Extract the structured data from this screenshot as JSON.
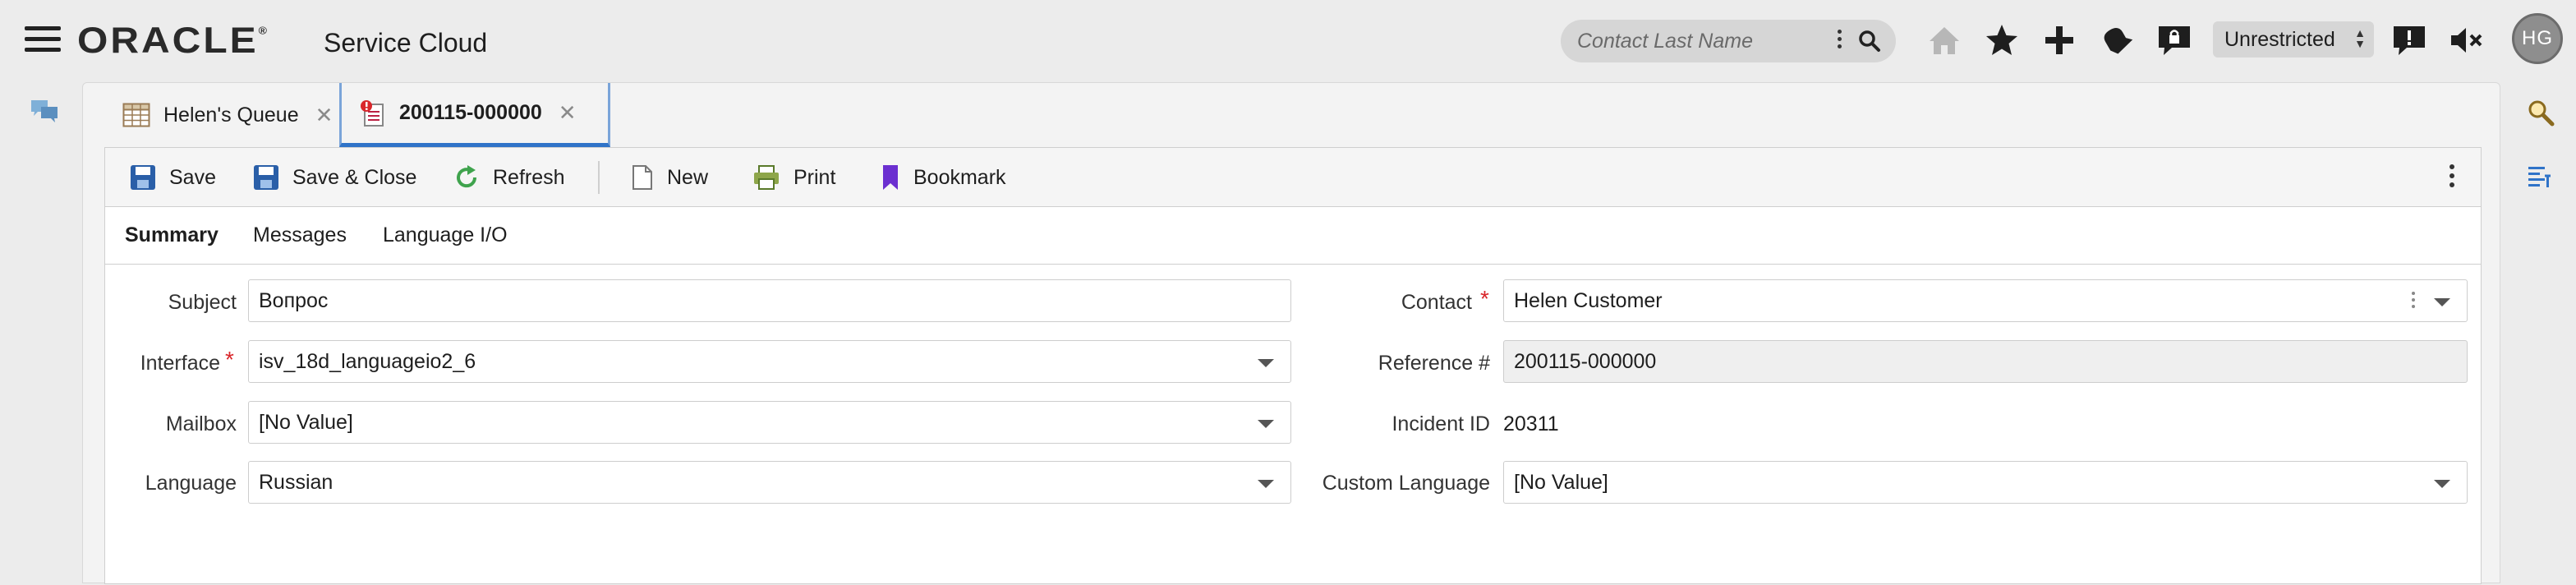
{
  "header": {
    "logo": "ORACLE",
    "logo_mark": "®",
    "product": "Service Cloud",
    "search": {
      "placeholder": "Contact Last Name",
      "value": ""
    },
    "privacy": "Unrestricted",
    "avatar_initials": "HG",
    "icons": [
      "home-icon",
      "star-icon",
      "plus-icon",
      "notifications-icon",
      "lock-chat-icon",
      "chat-icon",
      "mute-icon"
    ]
  },
  "tabs": [
    {
      "label": "Helen's Queue",
      "icon": "grid-table-icon"
    },
    {
      "label": "200115-000000",
      "icon": "incident-icon"
    }
  ],
  "toolbar": {
    "save": "Save",
    "save_close": "Save & Close",
    "refresh": "Refresh",
    "new": "New",
    "print": "Print",
    "bookmark": "Bookmark"
  },
  "subtabs": [
    "Summary",
    "Messages",
    "Language I/O"
  ],
  "form": {
    "subject": {
      "label": "Subject",
      "value": "Вопрос"
    },
    "interface": {
      "label": "Interface",
      "value": "isv_18d_languageio2_6"
    },
    "mailbox": {
      "label": "Mailbox",
      "value": "[No Value]"
    },
    "language": {
      "label": "Language",
      "value": "Russian"
    },
    "contact": {
      "label": "Contact",
      "value": "Helen Customer"
    },
    "reference": {
      "label": "Reference #",
      "value": "200115-000000"
    },
    "incident_id": {
      "label": "Incident ID",
      "value": "20311"
    },
    "custom_language": {
      "label": "Custom Language",
      "value": "[No Value]"
    },
    "required_mark": "*"
  },
  "colors": {
    "accent_blue": "#2f73c8",
    "required_red": "#d9262b",
    "bookmark_purple": "#6b2fd0",
    "refresh_green": "#3fa34d"
  }
}
